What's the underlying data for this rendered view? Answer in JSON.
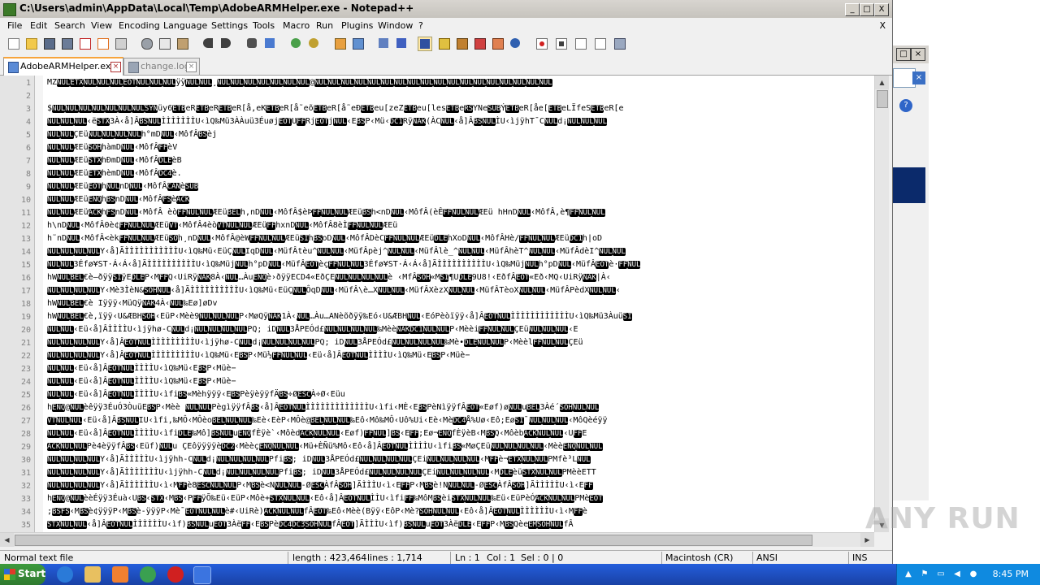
{
  "window": {
    "title": "C:\\Users\\admin\\AppData\\Local\\Temp\\AdobeARMHelper.exe - Notepad++",
    "min_label": "_",
    "max_label": "□",
    "close_label": "X"
  },
  "menu": {
    "items": [
      "File",
      "Edit",
      "Search",
      "View",
      "Encoding",
      "Language",
      "Settings",
      "Tools",
      "Macro",
      "Run",
      "Plugins",
      "Window",
      "?"
    ],
    "close_label": "X"
  },
  "toolbar": {
    "icons": [
      "new-file-icon",
      "open-file-icon",
      "save-icon",
      "save-all-icon",
      "close-icon",
      "close-all-icon",
      "print-icon",
      "cut-icon",
      "copy-icon",
      "paste-icon",
      "undo-icon",
      "redo-icon",
      "find-icon",
      "replace-icon",
      "zoom-in-icon",
      "zoom-out-icon",
      "sync-vertical-icon",
      "sync-horizontal-icon",
      "word-wrap-icon",
      "show-all-chars-icon",
      "indent-guide-icon",
      "user-lang-icon",
      "doc-map-icon",
      "function-list-icon",
      "folder-as-workspace-icon",
      "monitor-icon",
      "record-macro-icon",
      "stop-record-icon",
      "play-macro-icon",
      "play-multiple-icon",
      "save-macro-icon"
    ]
  },
  "tabs": [
    {
      "label": "AdobeARMHelper.exe",
      "active": true
    },
    {
      "label": "change.log",
      "active": false
    }
  ],
  "editor": {
    "lines": [
      {
        "n": "1",
        "text": "MZNULETXNULNULNULEOTNULNULNULÿÿNULNUL¸NULNULNULNULNULNULNUL@NULNULNULNULNULNULNULNULNULNULNULNULNULNULNULNULNULNUL"
      },
      {
        "n": "2",
        "text": ""
      },
      {
        "n": "3",
        "text": "$NULNULNULNULNULNULNULSYNüy6ETBeRETBeRETBeR[å,eKETBeR[å˜eõETBeR[å˜eÐETBeu[zeZETBeu[lesETBeRSYNeSUBÝETBeR[åe[ETBeLÏfeSETBeR[e"
      },
      {
        "n": "4",
        "text": "NULNULNUL‹ëSTX3À‹å]ÂBSNULÌÌÌÌÌÌÌU‹ìQ‰Mü3ÀÀuü3ÉuøjEOTUFFRjEOTjNUL‹EBSP‹Mü‹DC1RÿNAK(ÀCNUL‹å]ÂBSNULÌU‹ìjÿhT¯CNULd¡NULNULNUL"
      },
      {
        "n": "5",
        "text": "NULNULÇEüNULNULNULNULh°mDNUL‹MôfÂBSèj"
      },
      {
        "n": "6",
        "text": "NULNULÆEüSOHhàmDNUL‹MôfÂFFèV"
      },
      {
        "n": "7",
        "text": "NULNULÆEüSTXhÐmDNUL‹MôfÂDLEèB"
      },
      {
        "n": "8",
        "text": "NULNULÆEüETXhèmDNUL‹MôfÂDC4è."
      },
      {
        "n": "9",
        "text": "NULNULÆEüEOThNULnDNUL‹MôfÂCANèSUB"
      },
      {
        "n": "10",
        "text": "NULNULÆEüENQhBSnDNUL‹MôfÂFSèACK"
      },
      {
        "n": "11",
        "text": "NULNULÆEüACKhFSnDNUL‹MôfÂ èòFFNULNULÆEüBELh,nDNUL‹MôfÂ$èÞFFNULNULÆEüBSh<nDNUL‹MôfÂ(èÊFFNULNULÆEü hHnDNUL‹MôfÂ,è¶FFNULNUL"
      },
      {
        "n": "12",
        "text": "h\\nDNUL‹MôfÂ0è¢FFNULNULÆEüVT‹MôfÂ4èòVTNULNULÆEüFFhxnDNUL‹MôfÂ8èÌFFNULNULÆEü"
      },
      {
        "n": "13",
        "text": "h˜nDNUL‹MôfÂ<èkFFNULNULÆEüSOh¸nDNUL‹MôfÂ@èWFFNULNULÆEüSIhBSoDNUL‹MôfÂDèCFFNULNULÆEüDLEhXoDNUL‹MôfÂHè/FFNULNULÆEüDC1h|oD"
      },
      {
        "n": "14",
        "text": "NULNULNULNULY‹å]ÃÌÌÌÌÌÌÌÌÌÌÌU‹ìQ‰Mü‹EüÇNULIqDNUL‹MüfÂtèu^NULNUL‹MüfÂpèj^NULNUL‹MüfÂlè_^NULNUL‹MüfÂhèT^NULNUL‹MüfÂdèI^NULNUL"
      },
      {
        "n": "15",
        "text": "NULNUL3Éfø¥ST·Á‹Á‹å]ÃÌÌÌÌÌÌÌÌÌÌU‹ìQ‰MüjNULh°pDNUL‹MüfÂEOTèçFFNULNUL3Éfø¥ST·Á‹Á‹å]ÃÌÌÌÌÌÌÌÌÌÌU‹ìQ‰MüjNULh°pDNUL‹MüfÂEOTè·FFNUL"
      },
      {
        "n": "16",
        "text": "hWNULBEL€è—ðÿÿSIÿEDLEP‹MFFQ‹UiRÿNAK8À‹NUL…ÀuENQè›ðÿÿECD4«EðÇENULNULNULNULè ‹MfÂSOH«MSI¶UDLE9U8!‹EðfÂEOT«Eð‹MQ‹UiRÿNAK|À‹"
      },
      {
        "n": "17",
        "text": "NULNULNULNULY‹Mè3ÌèN&SOHNUL‹å]ÃÌÌÌÌÌÌÌÌÌÌU‹ìQ‰Mü‹EüÇNULÔqDNUL‹MüfÂ\\è…XNULNUL‹MüfÂXèzXNULNUL‹MüfÂTèoXNULNUL‹MüfÂPèdXNULNUL‹"
      },
      {
        "n": "18",
        "text": "hWNULBEL€è Iÿÿÿ‹MüQÿNAK4À‹NUL‰Eø]øDv"
      },
      {
        "n": "19",
        "text": "hWNULBEL€è,ïÿÿ‹U&ÆBHSOH‹EüP‹Mèè9NULNULNULP‹MøQÿNAK1À‹NUL…Àu…ANèõðÿÿ‰Eó‹U&ÆBHNUL‹EóPèòïÿÿ‹å]ÂEOTNULÌÌÌÌÌÌÌÌÌÌÌÌU‹ìQ‰Mü3ÀuüSI"
      },
      {
        "n": "20",
        "text": "NULNUL‹Eü‹å]ÂÌÌÌÌU‹ìjÿhø-CNULd¡NULNULNULNULPQ; iDNUL3ÅPEÓd£NULNULNULNUL‰MèèNAKDC1NULNULP‹MèèiFFNULNULÇEüNULNULNUL‹E"
      },
      {
        "n": "21",
        "text": "NULNULNULNULY‹å]ÂEOTNULÌÌÌÌÌÌÌÌÌU‹ìjÿhø-CNULd¡NULNULNULNULPQ; iDNUL3ÅPEÓd£NULNULNULNUL‰Mè•DLENULNULP‹MèèlFFNULNULÇEü"
      },
      {
        "n": "22",
        "text": "NULNULNULNULY‹å]ÂEOTNULÌÌÌÌÌÌÌÌÌU‹ìQ‰Mü‹EBSP‹Mü½FFNULNUL‹Eü‹å]ÂEOTNULÌÌÌÌU‹ìQ‰Mü‹EBSP‹Müè−"
      },
      {
        "n": "23",
        "text": "NULNUL‹Eü‹å]ÂEOTNULÌÌÌÌU‹ìQ‰Mü‹EBSP‹Müè−"
      },
      {
        "n": "24",
        "text": "NULNUL‹Eü‹å]ÂEOTNULÌÌÌÌU‹ìQ‰Mü‹EBSP‹Müè−"
      },
      {
        "n": "25",
        "text": "NULNUL‹Eü‹å]ÂEOTNULÌÌÌÌU‹ìfiBS«Mèhÿÿÿ‹EBSPèÿèÿÿfÄBS÷ØESCÀ÷Ø‹Eüu"
      },
      {
        "n": "26",
        "text": "hENQ@NULèêÿÿ3ÉuÓ3ÒuüEBSP‹Mèè NULNULPègìÿÿfÂBS‹å]ÂEOTNULÌÌÌÌÌÌÌÌÌÌÌÌÌU‹ìfi‹MÈ‹EBSPèNìÿÿfÂEOT«Eøf)øNULuBEL3Àé´SOHNULNUL"
      },
      {
        "n": "27",
        "text": "VTNULNUL‹Eü‹å]ÂBSNULIU‹ìfi,‰MÔ‹MÔèoBELNULNUL‰Eè‹EèP‹MÔè@BELNULNUL‰Eô‹Mô‰MÔ‹Uô%Ui‹Eè‹MèDC4Å%Uø‹Eô;EøSI¯NULNULNUL‹MôQèéÿÿ"
      },
      {
        "n": "28",
        "text": "NULNUL‹Eü‹å]ÂEOTNULÌÌÌÌU‹ìfiDLE‰Mô]BSNULuENQfÈÿè`‹MôèdACKNULNUL‹Eøf)FFNUL]BS‹EFF;Eø¬ENQfÈÿèB‹MBSQ‹MôèbACKNULNUL‹UFFE"
      },
      {
        "n": "29",
        "text": "ACKNULNULPè4èÿÿfÂBS‹Eüf)NULu ÇEôÿÿÿÿèDC2‹MèèçENQNULNUL‹Mü+ÈÑü%Mô‹Eô‹å]ÂEOTNULÌÌÌÌU‹ìfiBS«MøÇEüNULNULNULNUL‹MèèENQNULNUL"
      },
      {
        "n": "30",
        "text": "NULNULNULNULY‹å]ÃÌÌÌÌÌU‹ìjÿhh-CNULd¡NULNULNULNULPfiBS; iDNUL3ÅPEÓd£NULNULNULNULÇEiNULNULNULNUL‹MFFè¬ETXNULNULPMfè³LNUL"
      },
      {
        "n": "31",
        "text": "NULNULNULNULY‹å]ÃÌÌÌÌÌÌÌU‹ìjÿhh-CNULd¡NULNULNULNULPfiBS; iDNUL3ÅPEÓd£NULNULNULNULÇEiNULNULNULNUL‹MDLEèüSTXNULNULPMèèETT"
      },
      {
        "n": "32",
        "text": "NULNULNULNULY‹å]ÃÌÌÌÌÌÌU‹ì‹MFFè8ESCNULNULP‹MBSè<NNULNUL-ØESCÀfÂSOH]ÃÌÌÌU‹ì‹EFFP‹MBSè!NNULNUL-ØESCÀfÂSOH]ÃÌÌÌÌÌU‹ì‹EFF"
      },
      {
        "n": "33",
        "text": "hENQ@NULèèÉÿÿ3Éuà‹UBS‹STX‹MBS‹PFFÿÕ‰Eü‹EüP‹Môè+STXNULNUL‹Eô‹å]ÂEOTNULÌÌU‹ìfiFF‰MôMBSèiSTXNULNUL‰Eü‹EüPèÓACKNULNULPMèEOT"
      },
      {
        "n": "34",
        "text": ";BSFS‹MBSè¢ÿÿÿP‹MBSè-ÿÿÿP‹Mè¯EOTNULNULè#‹UiRè)ACKNULNULfÂEOT‰Eô‹Mèè(Bÿÿ‹EôP‹Mè?SOHNULNUL‹Eô‹å]ÂEOTNULÌÌÌÌÌÌU‹ì‹MFFè"
      },
      {
        "n": "35",
        "text": "STXNULNUL‹å]ÂEOTNULÌÌÌÌÌÌU‹ìf)BSNULuEOT3ÀëFF‹EBSPèDC4DC3SOHNULfÂEOT]ÃÌÌÌU‹ìf)BSNULuEOT3ÀëDLE‹EFFP‹MBSQèeEMSOHNULfÂ"
      }
    ]
  },
  "status": {
    "filetype": "Normal text file",
    "length": "length : 423,464",
    "lines": "lines : 1,714",
    "ln": "Ln : 1",
    "col": "Col : 1",
    "sel": "Sel : 0 | 0",
    "eol": "Macintosh (CR)",
    "encoding": "ANSI",
    "mode": "INS"
  },
  "taskbar": {
    "start_label": "Start",
    "clock": "8:45 PM"
  },
  "watermark": "ANY RUN",
  "colors": {
    "control_char_bg": "#000000",
    "control_char_fg": "#ffffff",
    "active_tab_accent": "#f7a43c",
    "taskbar_blue": "#245edb"
  }
}
